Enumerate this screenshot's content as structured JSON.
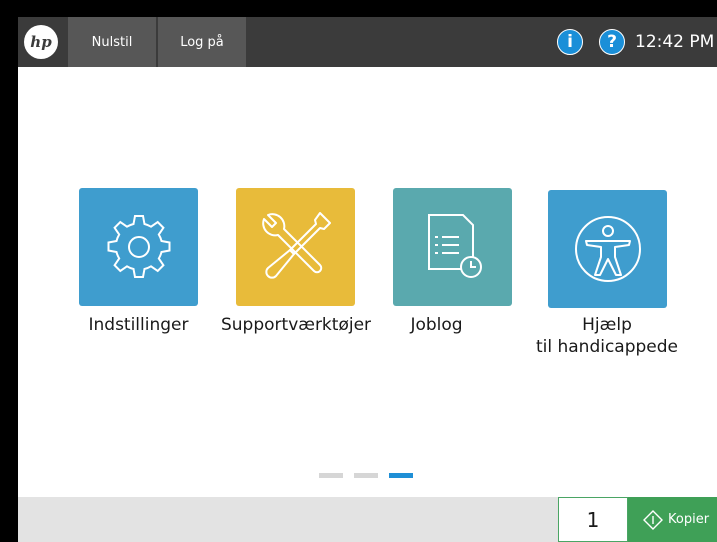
{
  "header": {
    "reset_label": "Nulstil",
    "signin_label": "Log på",
    "info_glyph": "i",
    "help_glyph": "?",
    "time": "12:42 PM",
    "logo_text": "hp"
  },
  "apps": [
    {
      "label": "Indstillinger",
      "icon": "gear-icon",
      "color": "#3f9dce"
    },
    {
      "label": "Supportværktøjer",
      "icon": "tools-icon",
      "color": "#e8bb3a"
    },
    {
      "label": "Joblog",
      "icon": "job-log-icon",
      "color": "#5aa9ae"
    },
    {
      "label_line1": "Hjælp",
      "label_line2": "til handicappede",
      "icon": "accessibility-icon",
      "color": "#3f9dce"
    }
  ],
  "pager": {
    "pages": 3,
    "current": 3
  },
  "footer": {
    "copies": "1",
    "copy_label": "Kopier",
    "copy_color": "#3fa057"
  }
}
